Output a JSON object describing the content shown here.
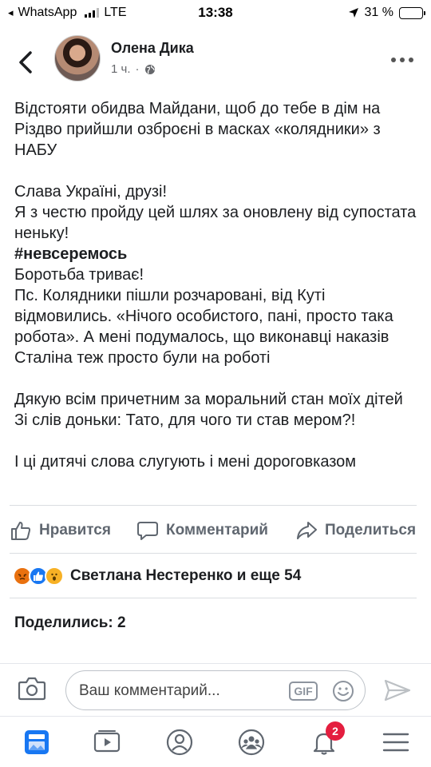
{
  "status_bar": {
    "back_app": "◂",
    "app": "WhatsApp",
    "network": "LTE",
    "time": "13:38",
    "battery": "31 %",
    "battery_level": 0.31
  },
  "post": {
    "author": "Олена Дика",
    "time": "1 ч.",
    "separator": "·",
    "paragraphs": [
      "Відстояти обидва Майдани, щоб до тебе в дім на Різдво прийшли озброєні в масках «колядники» з НАБУ",
      "",
      "Слава Україні, друзі!",
      "Я з честю пройду цей шлях за оновлену від супостата неньку!",
      "#невсеремось",
      "Боротьба триває!",
      "Пс. Колядники пішли розчаровані, від Куті відмовились. «Нічого особистого, пані, просто така робота».  А мені подумалось, що виконавці наказів Сталіна теж просто були на роботі",
      "",
      "Дякую всім причетним за моральний стан моїх дітей",
      "Зі слів доньки: Тато, для чого ти став мером?!",
      "",
      "І ці дитячі слова слугують і мені дороговказом"
    ]
  },
  "actions": {
    "like": "Нравится",
    "comment": "Комментарий",
    "share": "Поделиться"
  },
  "reactions": {
    "text": "Светлана Нестеренко и еще 54",
    "types": [
      "angry-reaction-icon",
      "like-reaction-icon",
      "wow-reaction-icon"
    ]
  },
  "shares_text": "Поделились: 2",
  "comment_box": {
    "placeholder": "Ваш комментарий...",
    "gif": "GIF"
  },
  "tabs": {
    "notifications_badge": "2",
    "icons": [
      "news-feed-icon",
      "watch-icon",
      "profile-icon",
      "groups-icon",
      "notifications-icon",
      "menu-icon"
    ]
  },
  "colors": {
    "accent": "#1877f2",
    "badge": "#e41e3f",
    "muted": "#606770"
  }
}
